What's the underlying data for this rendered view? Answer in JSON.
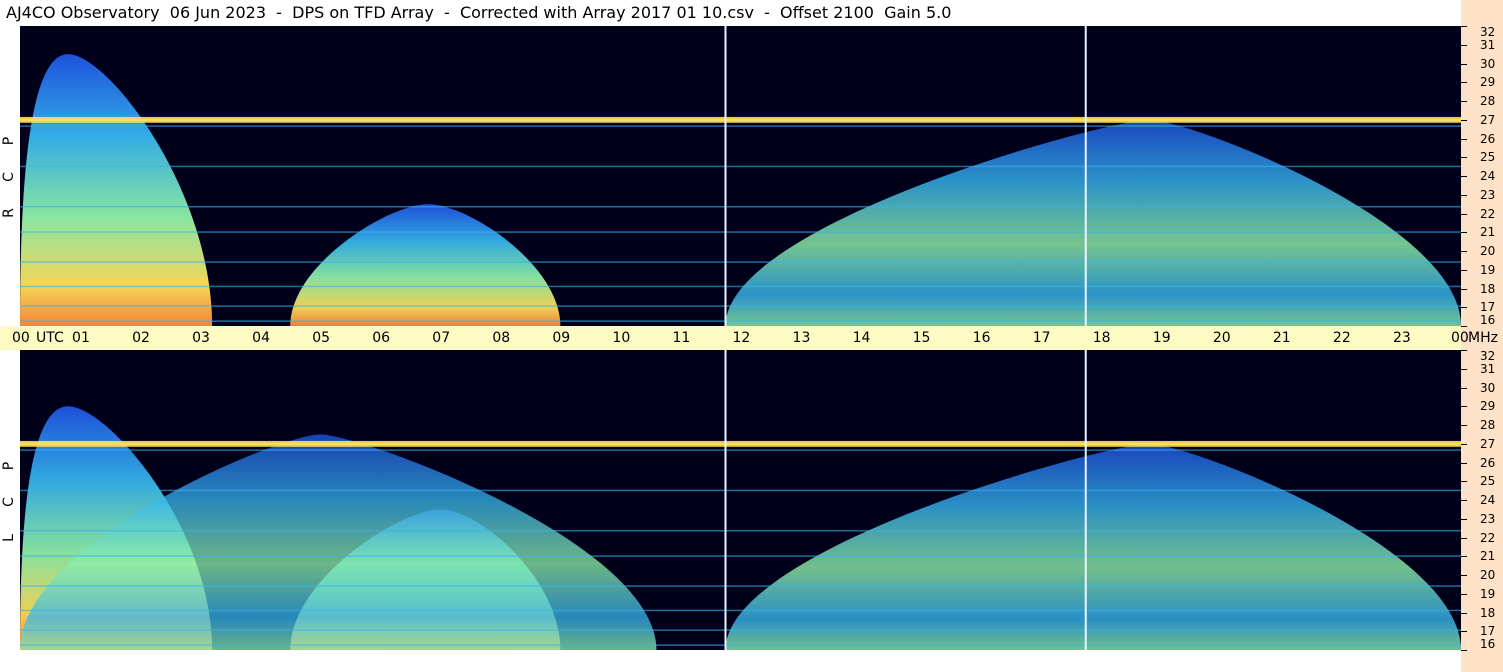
{
  "title": "AJ4CO Observatory  06 Jun 2023  -  DPS on TFD Array  -  Corrected with Array 2017 01 10.csv  -  Offset 2100  Gain 5.0",
  "utc_unit": "UTC",
  "freq_unit": "MHz",
  "polarization": {
    "upper": [
      "P",
      "C",
      "R"
    ],
    "lower": [
      "P",
      "C",
      "L"
    ]
  },
  "chart_data": {
    "type": "heatmap",
    "title": "AJ4CO Observatory  06 Jun 2023  -  DPS on TFD Array  -  Corrected with Array 2017 01 10.csv  -  Offset 2100  Gain 5.0",
    "xlabel": "UTC",
    "ylabel": "MHz",
    "x_ticks": [
      "00",
      "01",
      "02",
      "03",
      "04",
      "05",
      "06",
      "07",
      "08",
      "09",
      "10",
      "11",
      "12",
      "13",
      "14",
      "15",
      "16",
      "17",
      "18",
      "19",
      "20",
      "21",
      "22",
      "23",
      "00"
    ],
    "y_ticks": [
      "32",
      "31",
      "30",
      "29",
      "28",
      "27",
      "26",
      "25",
      "24",
      "23",
      "22",
      "21",
      "20",
      "19",
      "18",
      "17",
      "16"
    ],
    "xlim": [
      0,
      24
    ],
    "ylim": [
      16,
      32
    ],
    "panels": [
      "RCP",
      "LCP"
    ],
    "vertical_markers_utc": [
      11.75,
      17.75
    ],
    "colormap": [
      "#00001a",
      "#0a1a8c",
      "#1f55e6",
      "#35b4ee",
      "#8ff0a8",
      "#ffe05a",
      "#ff8a3c",
      "#ff3cc8"
    ],
    "intensity_features": [
      {
        "panel": "RCP",
        "utc_start": 0.0,
        "utc_end": 3.2,
        "f_low": 16,
        "f_high": 30.5,
        "peak_utc": 0.8,
        "level": 0.9
      },
      {
        "panel": "RCP",
        "utc_start": 4.5,
        "utc_end": 9.0,
        "f_low": 16,
        "f_high": 22.5,
        "peak_utc": 6.8,
        "level": 0.85
      },
      {
        "panel": "RCP",
        "utc_start": 11.75,
        "utc_end": 24.0,
        "f_low": 16,
        "f_high": 27,
        "peak_utc": 18.8,
        "level": 0.6
      },
      {
        "panel": "LCP",
        "utc_start": 0.0,
        "utc_end": 3.2,
        "f_low": 16,
        "f_high": 29,
        "peak_utc": 0.8,
        "level": 0.85
      },
      {
        "panel": "LCP",
        "utc_start": 4.5,
        "utc_end": 9.0,
        "f_low": 16,
        "f_high": 23.5,
        "peak_utc": 7.0,
        "level": 0.8
      },
      {
        "panel": "LCP",
        "utc_start": 0.0,
        "utc_end": 10.6,
        "f_low": 16,
        "f_high": 27.5,
        "peak_utc": 5.0,
        "level": 0.45
      },
      {
        "panel": "LCP",
        "utc_start": 11.75,
        "utc_end": 24.0,
        "f_low": 16,
        "f_high": 27,
        "peak_utc": 18.8,
        "level": 0.55
      }
    ]
  }
}
